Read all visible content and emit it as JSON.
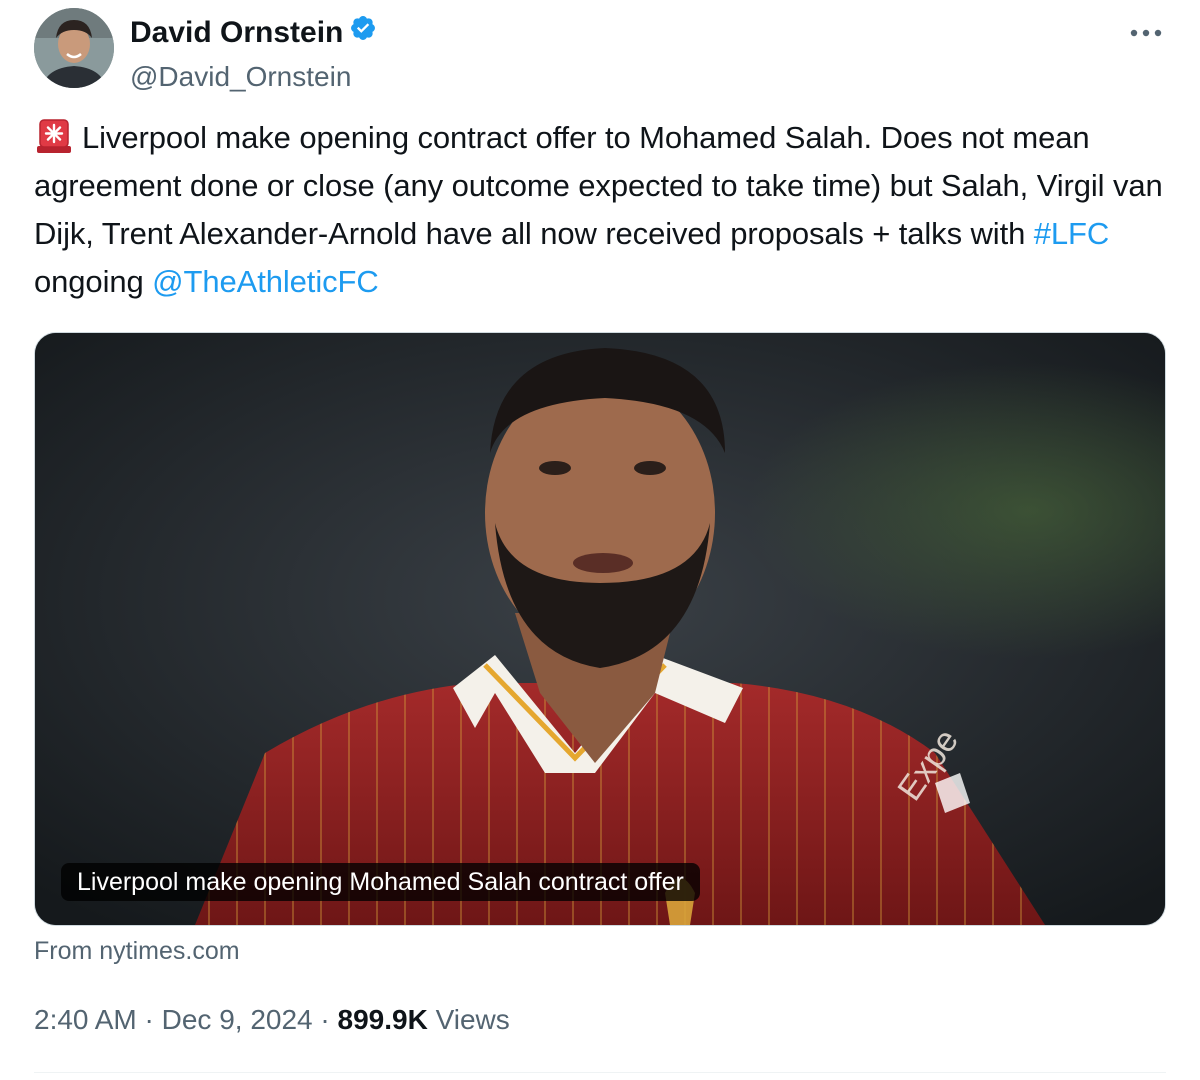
{
  "author": {
    "display_name": "David Ornstein",
    "handle": "@David_Ornstein",
    "verified": true,
    "verified_badge_color": "#1d9bf0"
  },
  "more_icon": "more-horizontal-icon",
  "tweet": {
    "emoji": "police-car-light-emoji",
    "text_part1": "Liverpool make opening contract offer to Mohamed Salah. Does not mean agreement done or close (any outcome expected to take time) but Salah, Virgil van Dijk, Trent Alexander-Arnold have all now received proposals + talks with ",
    "hashtag": "#LFC",
    "text_part2": " ongoing ",
    "mention": "@TheAthleticFC"
  },
  "link_card": {
    "caption": "Liverpool make opening Mohamed Salah contract offer",
    "source": "From nytimes.com"
  },
  "meta": {
    "time": "2:40 AM",
    "separator": " · ",
    "date": "Dec 9, 2024",
    "views_count": "899.9K",
    "views_label": " Views"
  },
  "colors": {
    "text_primary": "#0f1419",
    "text_secondary": "#536471",
    "link": "#1d9bf0",
    "border": "#cfd9de"
  }
}
